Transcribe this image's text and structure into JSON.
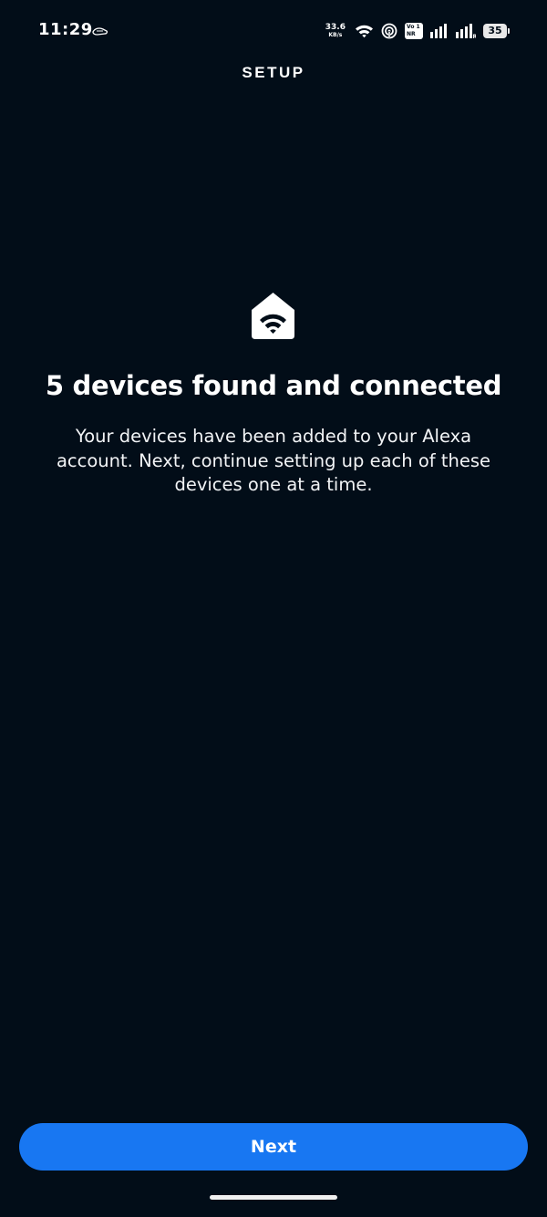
{
  "status_bar": {
    "time": "11:29",
    "net_speed_value": "33.6",
    "net_speed_unit": "KB/s",
    "volte_line1": "Vo 1",
    "volte_line2": "NR",
    "battery": "35",
    "icons": [
      "hand-gesture-icon",
      "wifi-icon",
      "hotspot-icon",
      "volte-icon",
      "signal-icon",
      "signal-roaming-icon",
      "battery-icon"
    ]
  },
  "header": {
    "title": "SETUP"
  },
  "main": {
    "icon": "smart-home-wifi-icon",
    "title": "5 devices found and connected",
    "description": "Your devices have been added to your Alexa account. Next, continue setting up each of these devices one at a time."
  },
  "footer": {
    "next_label": "Next"
  },
  "colors": {
    "background": "#020d18",
    "accent": "#1877f2",
    "text": "#ffffff"
  }
}
